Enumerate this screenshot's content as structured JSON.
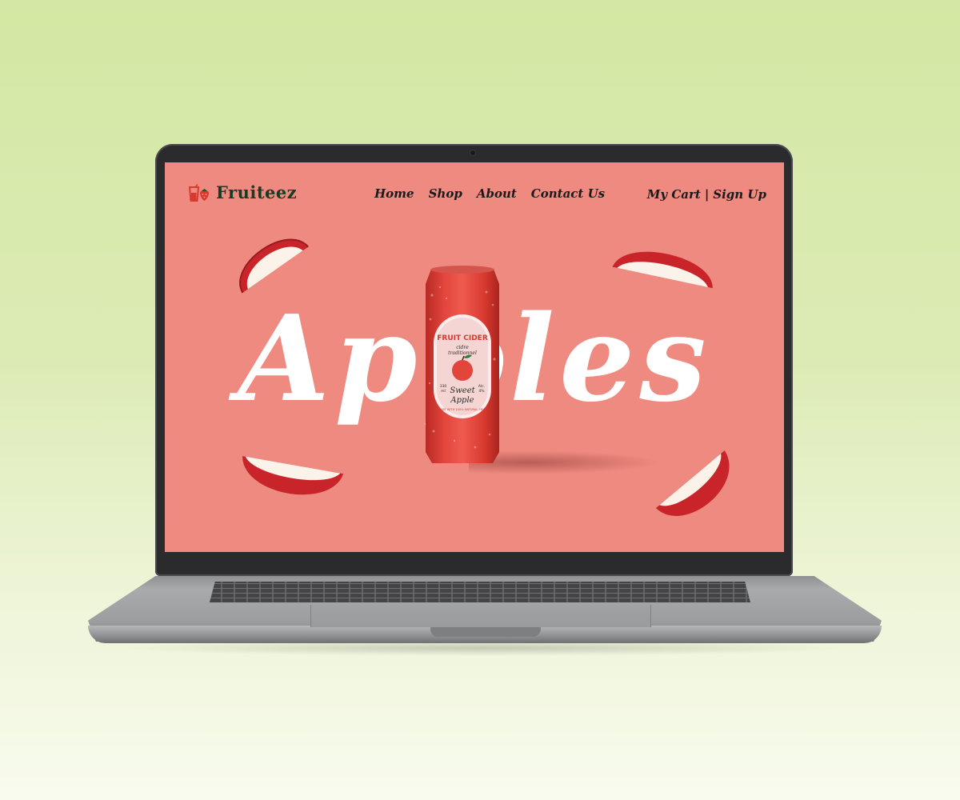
{
  "site": {
    "brand": "Fruiteez",
    "nav": [
      "Home",
      "Shop",
      "About",
      "Contact Us"
    ],
    "account": {
      "cart": "My Cart",
      "separator": "|",
      "signup": "Sign Up"
    }
  },
  "hero": {
    "word": "Apples",
    "product": {
      "title": "FRUIT CIDER",
      "subtitle_1": "cidre",
      "subtitle_2": "traditionnel",
      "volume": "330",
      "volume_unit": "ml",
      "alc_label": "Alc.",
      "alc_value": "4%",
      "name_1": "Sweet",
      "name_2": "Apple",
      "ribbon": "MADE WITH 100% NATURAL FRUIT"
    }
  },
  "colors": {
    "background": "#d3e8a3",
    "screen": "#ef8a80",
    "brand_text": "#153d26",
    "can": "#e2453c",
    "label": "#f4d5d3",
    "hero_text": "#ffffff"
  },
  "icons": {
    "logo": "juice-glass-strawberry-icon"
  }
}
